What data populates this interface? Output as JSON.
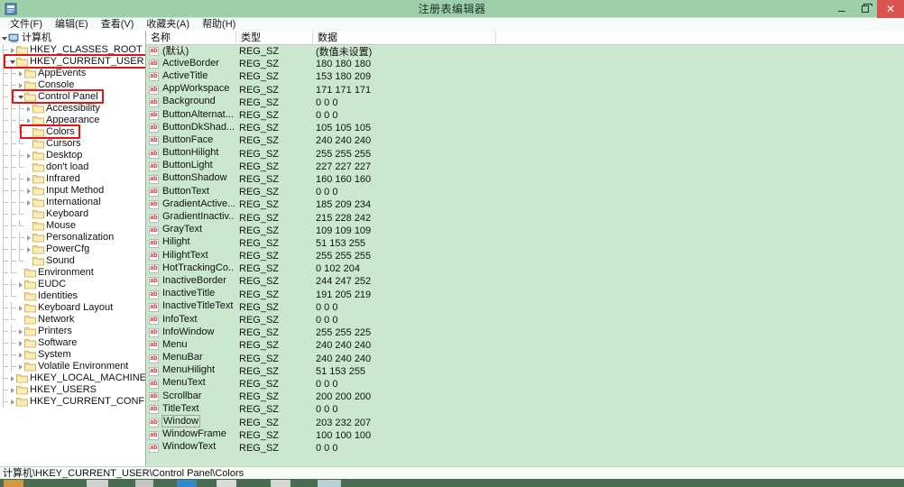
{
  "window": {
    "title": "注册表编辑器",
    "icon": "registry-editor-icon",
    "controls": {
      "minimize": "–",
      "restore": "❐",
      "close": "✕"
    }
  },
  "menubar": {
    "items": [
      {
        "label": "文件(F)",
        "name": "menu-file"
      },
      {
        "label": "编辑(E)",
        "name": "menu-edit"
      },
      {
        "label": "查看(V)",
        "name": "menu-view"
      },
      {
        "label": "收藏夹(A)",
        "name": "menu-favorites"
      },
      {
        "label": "帮助(H)",
        "name": "menu-help"
      }
    ]
  },
  "tree": {
    "nodes": [
      {
        "label": "计算机",
        "depth": 0,
        "state": "expanded",
        "icon": "computer-icon",
        "highlight": false
      },
      {
        "label": "HKEY_CLASSES_ROOT",
        "depth": 1,
        "state": "collapsed",
        "icon": "folder-icon",
        "highlight": false
      },
      {
        "label": "HKEY_CURRENT_USER",
        "depth": 1,
        "state": "expanded",
        "icon": "folder-icon",
        "highlight": true
      },
      {
        "label": "AppEvents",
        "depth": 2,
        "state": "collapsed",
        "icon": "folder-icon",
        "highlight": false
      },
      {
        "label": "Console",
        "depth": 2,
        "state": "collapsed",
        "icon": "folder-icon",
        "highlight": false
      },
      {
        "label": "Control Panel",
        "depth": 2,
        "state": "expanded",
        "icon": "folder-icon",
        "highlight": true
      },
      {
        "label": "Accessibility",
        "depth": 3,
        "state": "collapsed",
        "icon": "folder-icon",
        "highlight": false
      },
      {
        "label": "Appearance",
        "depth": 3,
        "state": "collapsed",
        "icon": "folder-icon",
        "highlight": false
      },
      {
        "label": "Colors",
        "depth": 3,
        "state": "leaf",
        "icon": "folder-icon",
        "highlight": true
      },
      {
        "label": "Cursors",
        "depth": 3,
        "state": "leaf",
        "icon": "folder-icon",
        "highlight": false
      },
      {
        "label": "Desktop",
        "depth": 3,
        "state": "collapsed",
        "icon": "folder-icon",
        "highlight": false
      },
      {
        "label": "don't load",
        "depth": 3,
        "state": "leaf",
        "icon": "folder-icon",
        "highlight": false
      },
      {
        "label": "Infrared",
        "depth": 3,
        "state": "collapsed",
        "icon": "folder-icon",
        "highlight": false
      },
      {
        "label": "Input Method",
        "depth": 3,
        "state": "collapsed",
        "icon": "folder-icon",
        "highlight": false
      },
      {
        "label": "International",
        "depth": 3,
        "state": "collapsed",
        "icon": "folder-icon",
        "highlight": false
      },
      {
        "label": "Keyboard",
        "depth": 3,
        "state": "leaf",
        "icon": "folder-icon",
        "highlight": false
      },
      {
        "label": "Mouse",
        "depth": 3,
        "state": "leaf",
        "icon": "folder-icon",
        "highlight": false
      },
      {
        "label": "Personalization",
        "depth": 3,
        "state": "collapsed",
        "icon": "folder-icon",
        "highlight": false
      },
      {
        "label": "PowerCfg",
        "depth": 3,
        "state": "collapsed",
        "icon": "folder-icon",
        "highlight": false
      },
      {
        "label": "Sound",
        "depth": 3,
        "state": "leaf",
        "icon": "folder-icon",
        "highlight": false
      },
      {
        "label": "Environment",
        "depth": 2,
        "state": "leaf",
        "icon": "folder-icon",
        "highlight": false
      },
      {
        "label": "EUDC",
        "depth": 2,
        "state": "collapsed",
        "icon": "folder-icon",
        "highlight": false
      },
      {
        "label": "Identities",
        "depth": 2,
        "state": "leaf",
        "icon": "folder-icon",
        "highlight": false
      },
      {
        "label": "Keyboard Layout",
        "depth": 2,
        "state": "collapsed",
        "icon": "folder-icon",
        "highlight": false
      },
      {
        "label": "Network",
        "depth": 2,
        "state": "leaf",
        "icon": "folder-icon",
        "highlight": false
      },
      {
        "label": "Printers",
        "depth": 2,
        "state": "collapsed",
        "icon": "folder-icon",
        "highlight": false
      },
      {
        "label": "Software",
        "depth": 2,
        "state": "collapsed",
        "icon": "folder-icon",
        "highlight": false
      },
      {
        "label": "System",
        "depth": 2,
        "state": "collapsed",
        "icon": "folder-icon",
        "highlight": false
      },
      {
        "label": "Volatile Environment",
        "depth": 2,
        "state": "collapsed",
        "icon": "folder-icon",
        "highlight": false
      },
      {
        "label": "HKEY_LOCAL_MACHINE",
        "depth": 1,
        "state": "collapsed",
        "icon": "folder-icon",
        "highlight": false
      },
      {
        "label": "HKEY_USERS",
        "depth": 1,
        "state": "collapsed",
        "icon": "folder-icon",
        "highlight": false
      },
      {
        "label": "HKEY_CURRENT_CONFIG",
        "depth": 1,
        "state": "collapsed",
        "icon": "folder-icon",
        "highlight": false
      }
    ]
  },
  "list": {
    "columns": [
      {
        "label": "名称",
        "key": "name"
      },
      {
        "label": "类型",
        "key": "type"
      },
      {
        "label": "数据",
        "key": "data"
      }
    ],
    "value_icon": "ab",
    "rows": [
      {
        "name": "(默认)",
        "type": "REG_SZ",
        "data": "(数值未设置)",
        "selected": false
      },
      {
        "name": "ActiveBorder",
        "type": "REG_SZ",
        "data": "180 180 180",
        "selected": false
      },
      {
        "name": "ActiveTitle",
        "type": "REG_SZ",
        "data": "153 180 209",
        "selected": false
      },
      {
        "name": "AppWorkspace",
        "type": "REG_SZ",
        "data": "171 171 171",
        "selected": false
      },
      {
        "name": "Background",
        "type": "REG_SZ",
        "data": "0 0 0",
        "selected": false
      },
      {
        "name": "ButtonAlternat...",
        "type": "REG_SZ",
        "data": "0 0 0",
        "selected": false
      },
      {
        "name": "ButtonDkShad...",
        "type": "REG_SZ",
        "data": "105 105 105",
        "selected": false
      },
      {
        "name": "ButtonFace",
        "type": "REG_SZ",
        "data": "240 240 240",
        "selected": false
      },
      {
        "name": "ButtonHilight",
        "type": "REG_SZ",
        "data": "255 255 255",
        "selected": false
      },
      {
        "name": "ButtonLight",
        "type": "REG_SZ",
        "data": "227 227 227",
        "selected": false
      },
      {
        "name": "ButtonShadow",
        "type": "REG_SZ",
        "data": "160 160 160",
        "selected": false
      },
      {
        "name": "ButtonText",
        "type": "REG_SZ",
        "data": "0 0 0",
        "selected": false
      },
      {
        "name": "GradientActive...",
        "type": "REG_SZ",
        "data": "185 209 234",
        "selected": false
      },
      {
        "name": "GradientInactiv...",
        "type": "REG_SZ",
        "data": "215 228 242",
        "selected": false
      },
      {
        "name": "GrayText",
        "type": "REG_SZ",
        "data": "109 109 109",
        "selected": false
      },
      {
        "name": "Hilight",
        "type": "REG_SZ",
        "data": "51 153 255",
        "selected": false
      },
      {
        "name": "HilightText",
        "type": "REG_SZ",
        "data": "255 255 255",
        "selected": false
      },
      {
        "name": "HotTrackingCo...",
        "type": "REG_SZ",
        "data": "0 102 204",
        "selected": false
      },
      {
        "name": "InactiveBorder",
        "type": "REG_SZ",
        "data": "244 247 252",
        "selected": false
      },
      {
        "name": "InactiveTitle",
        "type": "REG_SZ",
        "data": "191 205 219",
        "selected": false
      },
      {
        "name": "InactiveTitleText",
        "type": "REG_SZ",
        "data": "0 0 0",
        "selected": false
      },
      {
        "name": "InfoText",
        "type": "REG_SZ",
        "data": "0 0 0",
        "selected": false
      },
      {
        "name": "InfoWindow",
        "type": "REG_SZ",
        "data": "255 255 225",
        "selected": false
      },
      {
        "name": "Menu",
        "type": "REG_SZ",
        "data": "240 240 240",
        "selected": false
      },
      {
        "name": "MenuBar",
        "type": "REG_SZ",
        "data": "240 240 240",
        "selected": false
      },
      {
        "name": "MenuHilight",
        "type": "REG_SZ",
        "data": "51 153 255",
        "selected": false
      },
      {
        "name": "MenuText",
        "type": "REG_SZ",
        "data": "0 0 0",
        "selected": false
      },
      {
        "name": "Scrollbar",
        "type": "REG_SZ",
        "data": "200 200 200",
        "selected": false
      },
      {
        "name": "TitleText",
        "type": "REG_SZ",
        "data": "0 0 0",
        "selected": false
      },
      {
        "name": "Window",
        "type": "REG_SZ",
        "data": "203 232 207",
        "selected": true
      },
      {
        "name": "WindowFrame",
        "type": "REG_SZ",
        "data": "100 100 100",
        "selected": false
      },
      {
        "name": "WindowText",
        "type": "REG_SZ",
        "data": "0 0 0",
        "selected": false
      }
    ]
  },
  "statusbar": {
    "path": "计算机\\HKEY_CURRENT_USER\\Control Panel\\Colors"
  },
  "taskbar": {
    "icons": [
      "start-orb",
      "explorer-icon",
      "media-icon",
      "browser-icon",
      "app-icon",
      "circle-icon",
      "window-icon"
    ]
  },
  "colors": {
    "titlebar": "#9dcfab",
    "close_button": "#d9534f",
    "list_background": "#cbe8cf",
    "annotation_red": "#e81313",
    "tree_background": "#ffffff"
  }
}
